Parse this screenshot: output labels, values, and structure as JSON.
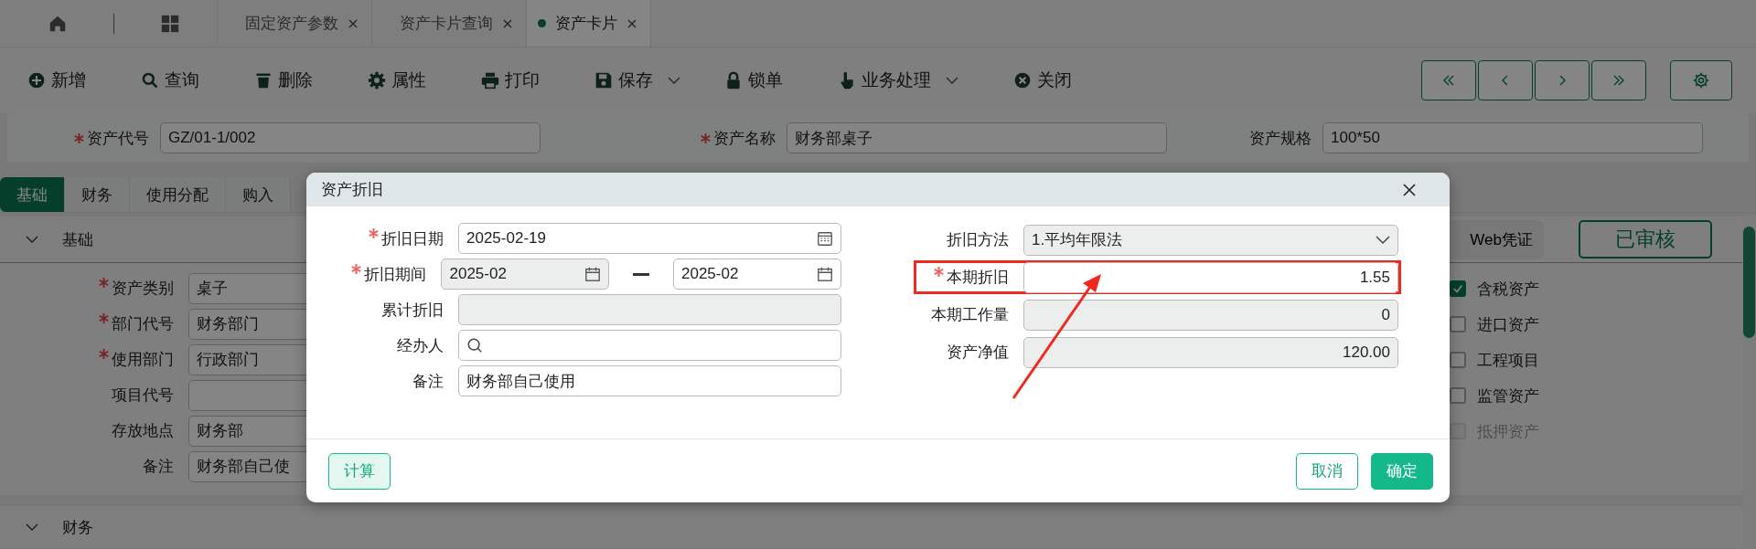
{
  "tab_bar": {
    "tabs": [
      {
        "label": "固定资产参数",
        "selected": false
      },
      {
        "label": "资产卡片查询",
        "selected": false
      },
      {
        "label": "资产卡片",
        "selected": true
      }
    ]
  },
  "toolbar": {
    "buttons": [
      {
        "label": "新增",
        "dropdown": false
      },
      {
        "label": "查询",
        "dropdown": false
      },
      {
        "label": "删除",
        "dropdown": false
      },
      {
        "label": "属性",
        "dropdown": false
      },
      {
        "label": "打印",
        "dropdown": false
      },
      {
        "label": "保存",
        "dropdown": true
      },
      {
        "label": "锁单",
        "dropdown": false
      },
      {
        "label": "业务处理",
        "dropdown": true
      },
      {
        "label": "关闭",
        "dropdown": false
      }
    ]
  },
  "header_fields": [
    {
      "label": "资产代号",
      "required": true,
      "value": "GZ/01-1/002"
    },
    {
      "label": "资产名称",
      "required": true,
      "value": "财务部桌子"
    },
    {
      "label": "资产规格",
      "required": false,
      "value": "100*50"
    }
  ],
  "form_tabs": [
    {
      "label": "基础",
      "selected": true
    },
    {
      "label": "财务",
      "selected": false
    },
    {
      "label": "使用分配",
      "selected": false
    },
    {
      "label": "购入",
      "selected": false
    }
  ],
  "basic_section": {
    "title": "基础",
    "fields": [
      {
        "label": "资产类别",
        "required": true,
        "value": "桌子"
      },
      {
        "label": "部门代号",
        "required": true,
        "value": "财务部门"
      },
      {
        "label": "使用部门",
        "required": true,
        "value": "行政部门"
      },
      {
        "label": "项目代号",
        "required": false
      },
      {
        "label": "存放地点",
        "required": false,
        "value": "财务部"
      },
      {
        "label": "备注",
        "required": false,
        "value": "财务部自己使"
      }
    ],
    "web_voucher_button": "Web凭证",
    "status_stamp": "已审核",
    "flags": [
      {
        "label": "含税资产",
        "checked": true,
        "disabled": false
      },
      {
        "label": "进口资产",
        "checked": false,
        "disabled": false
      },
      {
        "label": "工程项目",
        "checked": false,
        "disabled": false
      },
      {
        "label": "监管资产",
        "checked": false,
        "disabled": false
      },
      {
        "label": "抵押资产",
        "checked": false,
        "disabled": true
      }
    ]
  },
  "finance_section": {
    "title": "财务"
  },
  "dialog": {
    "title": "资产折旧",
    "left_fields": [
      {
        "kind": "date",
        "label": "折旧日期",
        "required": true,
        "value": "2025-02-19",
        "readonly": false
      },
      {
        "kind": "period",
        "label": "折旧期间",
        "required": true,
        "value": "2025-02",
        "value_to": "2025-02",
        "readonly": true
      },
      {
        "kind": "text",
        "label": "累计折旧",
        "required": false,
        "readonly": true
      },
      {
        "kind": "search",
        "label": "经办人",
        "required": false,
        "readonly": false
      },
      {
        "kind": "text",
        "label": "备注",
        "required": false,
        "value": "财务部自己使用",
        "readonly": false
      }
    ],
    "right_fields": [
      {
        "kind": "select",
        "label": "折旧方法",
        "required": false,
        "value": "1.平均年限法",
        "readonly": true,
        "highlighted": false
      },
      {
        "kind": "number",
        "label": "本期折旧",
        "required": true,
        "value": "1.55",
        "readonly": false,
        "highlighted": true
      },
      {
        "kind": "number",
        "label": "本期工作量",
        "required": false,
        "value": "0",
        "readonly": true,
        "highlighted": false
      },
      {
        "kind": "number",
        "label": "资产净值",
        "required": false,
        "value": "120.00",
        "readonly": true,
        "highlighted": false
      }
    ],
    "buttons": [
      {
        "kind": "secondary",
        "label": "计算"
      },
      {
        "kind": "outline",
        "label": "取消"
      },
      {
        "kind": "primary",
        "label": "确定"
      }
    ]
  }
}
